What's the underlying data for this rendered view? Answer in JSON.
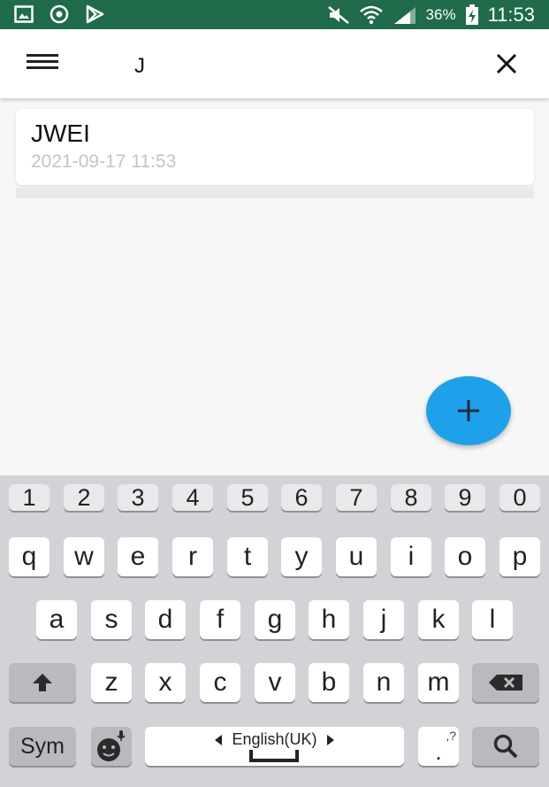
{
  "status_bar": {
    "battery_percent": "36%",
    "time": "11:53",
    "left_icons": [
      "image-icon",
      "sync-icon",
      "play-store-icon"
    ],
    "right_icons": [
      "mute-icon",
      "wifi-icon",
      "signal-icon",
      "battery-charging-icon"
    ]
  },
  "search": {
    "value": "J"
  },
  "results": [
    {
      "title": "JWEI",
      "date": "2021-09-17 11:53"
    }
  ],
  "colors": {
    "status_bar": "#1f6b4a",
    "fab": "#1ea1ea",
    "keyboard": "#d2d3d7"
  },
  "keyboard": {
    "numbers": [
      "1",
      "2",
      "3",
      "4",
      "5",
      "6",
      "7",
      "8",
      "9",
      "0"
    ],
    "row1": [
      "q",
      "w",
      "e",
      "r",
      "t",
      "y",
      "u",
      "i",
      "o",
      "p"
    ],
    "row2": [
      "a",
      "s",
      "d",
      "f",
      "g",
      "h",
      "j",
      "k",
      "l"
    ],
    "row3": [
      "z",
      "x",
      "c",
      "v",
      "b",
      "n",
      "m"
    ],
    "sym_label": "Sym",
    "space_label": "English(UK)",
    "punct_label": ".",
    "punct_hint": ",?"
  }
}
